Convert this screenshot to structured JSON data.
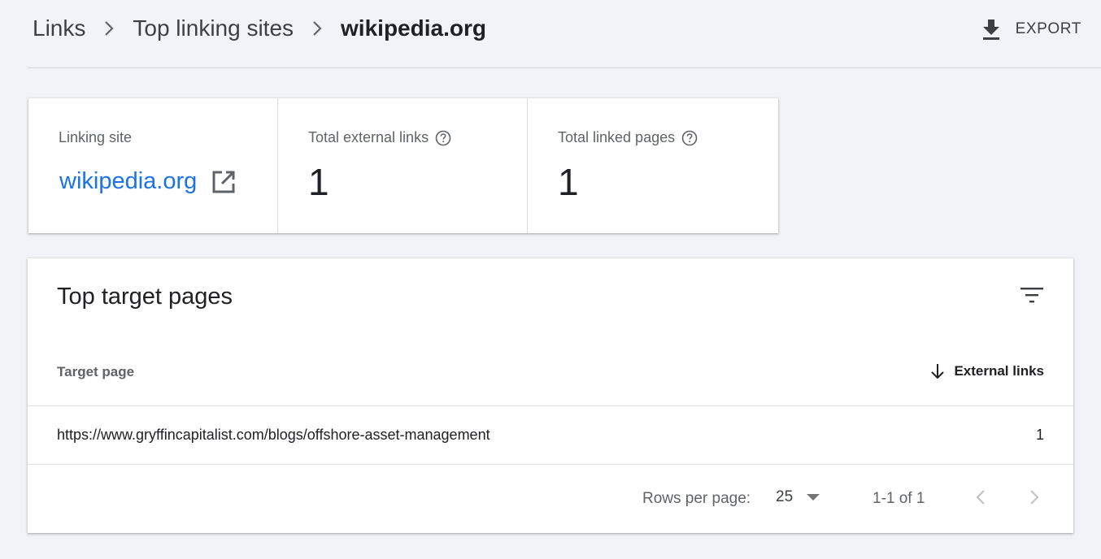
{
  "breadcrumb": {
    "items": [
      "Links",
      "Top linking sites",
      "wikipedia.org"
    ]
  },
  "toolbar": {
    "export_label": "EXPORT"
  },
  "summary": {
    "linking_site_label": "Linking site",
    "linking_site_value": "wikipedia.org",
    "total_external_links_label": "Total external links",
    "total_external_links_value": "1",
    "total_linked_pages_label": "Total linked pages",
    "total_linked_pages_value": "1"
  },
  "table": {
    "title": "Top target pages",
    "columns": [
      "Target page",
      "External links"
    ],
    "sort": "External links, descending",
    "rows": [
      {
        "target_page": "https://www.gryffincapitalist.com/blogs/offshore-asset-management",
        "external_links": "1"
      }
    ]
  },
  "pagination": {
    "rows_per_page_label": "Rows per page:",
    "rows_per_page_value": "25",
    "range_text": "1-1 of 1"
  },
  "colors": {
    "background": "#f1f3f8",
    "link": "#1a73e8",
    "text": "#202124",
    "secondary_text": "#5f6368"
  },
  "icons": [
    "chevron-right-icon",
    "download-icon",
    "help-circle-icon",
    "open-in-new-icon",
    "filter-list-icon",
    "arrow-down-icon",
    "dropdown-caret-icon",
    "chevron-left-icon"
  ]
}
